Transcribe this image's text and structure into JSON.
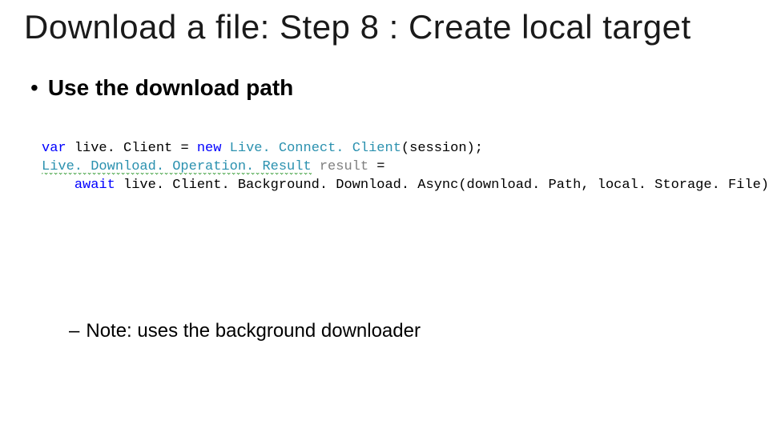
{
  "title": "Download a file: Step 8 : Create local target",
  "bullet": {
    "marker": "•",
    "text": "Use the download path"
  },
  "code": {
    "l1": {
      "kw_var": "var",
      "sp1": " ",
      "live": "live. ",
      "client": "Client",
      "sp2": " ",
      "eq": "=",
      "sp3": " ",
      "kw_new": "new",
      "sp4": " ",
      "type": "Live. Connect. Client",
      "open": "(",
      "arg": "session",
      "close": ");"
    },
    "l2": {
      "type": "Live. Download. Operation. Result",
      "sp1": " ",
      "result": "result",
      "sp2": " ",
      "eq": "="
    },
    "l3": {
      "indent": "    ",
      "kw_await": "await",
      "sp1": " ",
      "obj": "live. Client. Background. Download. Async",
      "open": "(",
      "arg1": "download. Path",
      "comma": ", ",
      "arg2": "local. Storage. File",
      "close": ");"
    }
  },
  "sub": {
    "dash": "–",
    "text": "Note: uses the background downloader"
  }
}
